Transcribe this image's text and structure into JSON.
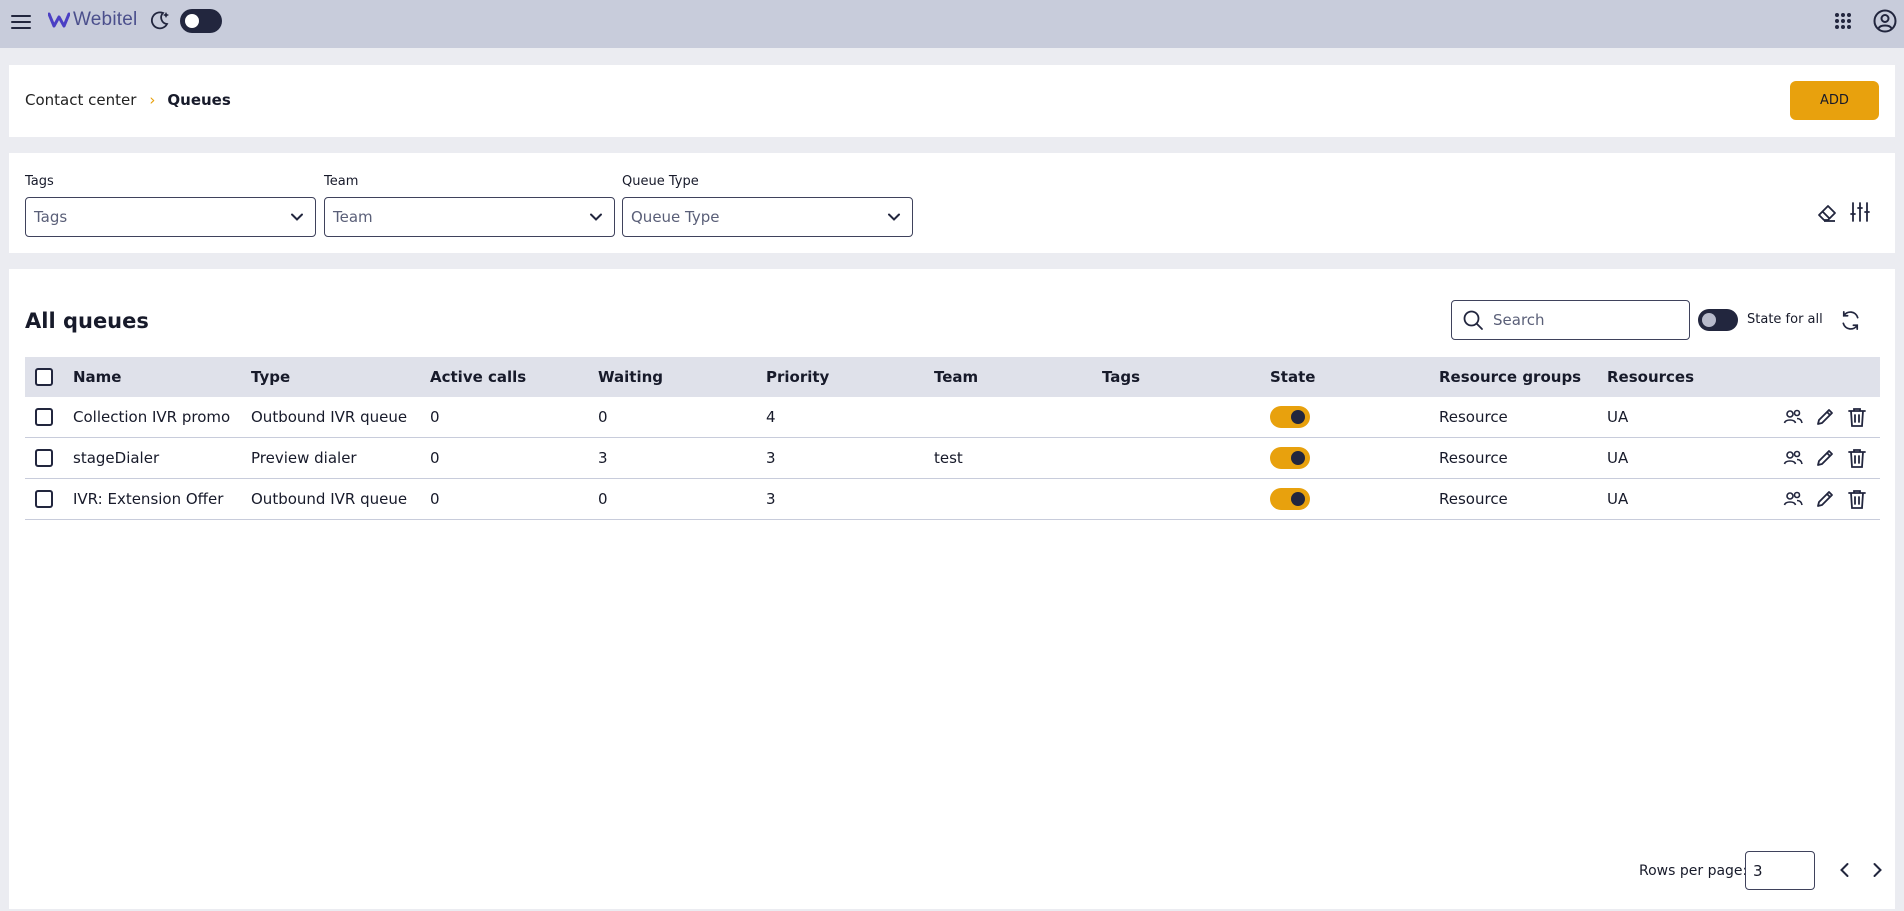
{
  "app": {
    "logo_text": "Webitel"
  },
  "breadcrumb": {
    "parent": "Contact center",
    "current": "Queues",
    "separator": "›"
  },
  "header": {
    "add_label": "ADD"
  },
  "filters": [
    {
      "label": "Tags",
      "placeholder": "Tags"
    },
    {
      "label": "Team",
      "placeholder": "Team"
    },
    {
      "label": "Queue Type",
      "placeholder": "Queue Type"
    }
  ],
  "table": {
    "title": "All queues",
    "search_placeholder": "Search",
    "state_all_label": "State for all",
    "columns": [
      "Name",
      "Type",
      "Active calls",
      "Waiting",
      "Priority",
      "Team",
      "Tags",
      "State",
      "Resource groups",
      "Resources"
    ],
    "rows": [
      {
        "name": "Collection IVR promo",
        "type": "Outbound IVR queue",
        "active_calls": "0",
        "waiting": "0",
        "priority": "4",
        "team": "",
        "tags": "",
        "state": true,
        "resource_groups": "Resource",
        "resources": "UA"
      },
      {
        "name": "stageDialer",
        "type": "Preview dialer",
        "active_calls": "0",
        "waiting": "3",
        "priority": "3",
        "team": "test",
        "tags": "",
        "state": true,
        "resource_groups": "Resource",
        "resources": "UA"
      },
      {
        "name": "IVR: Extension Offer",
        "type": "Outbound IVR queue",
        "active_calls": "0",
        "waiting": "0",
        "priority": "3",
        "team": "",
        "tags": "",
        "state": true,
        "resource_groups": "Resource",
        "resources": "UA"
      }
    ]
  },
  "pagination": {
    "rows_per_page_label": "Rows per page:",
    "rows_per_page": "3"
  },
  "colors": {
    "accent": "#e8a10d",
    "topbar": "#c8ccdb",
    "dark": "#22263e",
    "background": "#ebecf1"
  }
}
